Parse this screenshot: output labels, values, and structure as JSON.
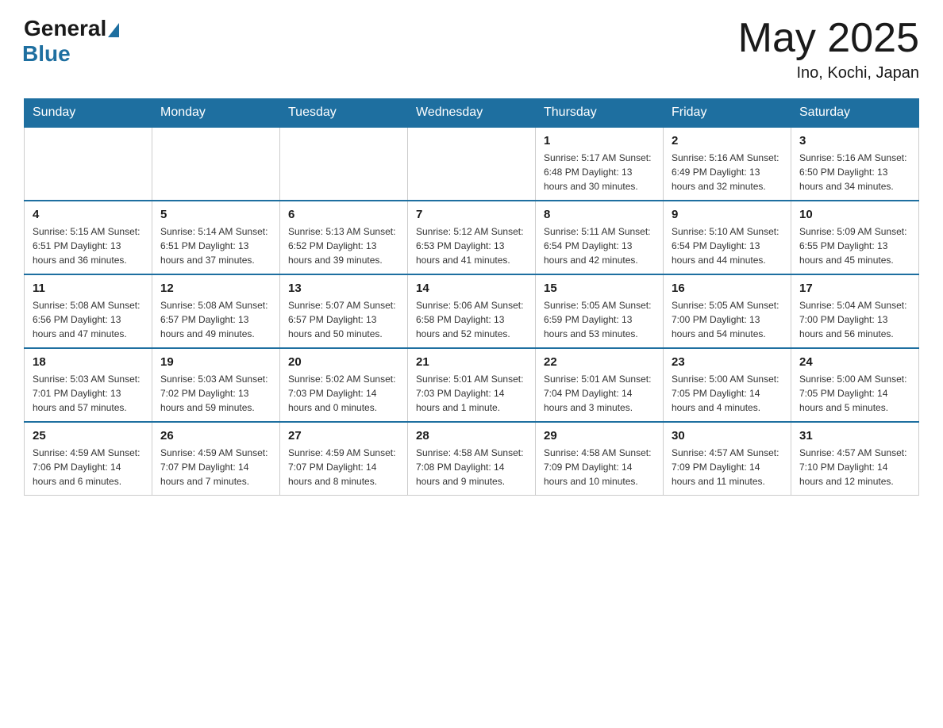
{
  "header": {
    "logo_general": "General",
    "logo_blue": "Blue",
    "month": "May 2025",
    "location": "Ino, Kochi, Japan"
  },
  "weekdays": [
    "Sunday",
    "Monday",
    "Tuesday",
    "Wednesday",
    "Thursday",
    "Friday",
    "Saturday"
  ],
  "weeks": [
    [
      {
        "day": "",
        "info": ""
      },
      {
        "day": "",
        "info": ""
      },
      {
        "day": "",
        "info": ""
      },
      {
        "day": "",
        "info": ""
      },
      {
        "day": "1",
        "info": "Sunrise: 5:17 AM\nSunset: 6:48 PM\nDaylight: 13 hours\nand 30 minutes."
      },
      {
        "day": "2",
        "info": "Sunrise: 5:16 AM\nSunset: 6:49 PM\nDaylight: 13 hours\nand 32 minutes."
      },
      {
        "day": "3",
        "info": "Sunrise: 5:16 AM\nSunset: 6:50 PM\nDaylight: 13 hours\nand 34 minutes."
      }
    ],
    [
      {
        "day": "4",
        "info": "Sunrise: 5:15 AM\nSunset: 6:51 PM\nDaylight: 13 hours\nand 36 minutes."
      },
      {
        "day": "5",
        "info": "Sunrise: 5:14 AM\nSunset: 6:51 PM\nDaylight: 13 hours\nand 37 minutes."
      },
      {
        "day": "6",
        "info": "Sunrise: 5:13 AM\nSunset: 6:52 PM\nDaylight: 13 hours\nand 39 minutes."
      },
      {
        "day": "7",
        "info": "Sunrise: 5:12 AM\nSunset: 6:53 PM\nDaylight: 13 hours\nand 41 minutes."
      },
      {
        "day": "8",
        "info": "Sunrise: 5:11 AM\nSunset: 6:54 PM\nDaylight: 13 hours\nand 42 minutes."
      },
      {
        "day": "9",
        "info": "Sunrise: 5:10 AM\nSunset: 6:54 PM\nDaylight: 13 hours\nand 44 minutes."
      },
      {
        "day": "10",
        "info": "Sunrise: 5:09 AM\nSunset: 6:55 PM\nDaylight: 13 hours\nand 45 minutes."
      }
    ],
    [
      {
        "day": "11",
        "info": "Sunrise: 5:08 AM\nSunset: 6:56 PM\nDaylight: 13 hours\nand 47 minutes."
      },
      {
        "day": "12",
        "info": "Sunrise: 5:08 AM\nSunset: 6:57 PM\nDaylight: 13 hours\nand 49 minutes."
      },
      {
        "day": "13",
        "info": "Sunrise: 5:07 AM\nSunset: 6:57 PM\nDaylight: 13 hours\nand 50 minutes."
      },
      {
        "day": "14",
        "info": "Sunrise: 5:06 AM\nSunset: 6:58 PM\nDaylight: 13 hours\nand 52 minutes."
      },
      {
        "day": "15",
        "info": "Sunrise: 5:05 AM\nSunset: 6:59 PM\nDaylight: 13 hours\nand 53 minutes."
      },
      {
        "day": "16",
        "info": "Sunrise: 5:05 AM\nSunset: 7:00 PM\nDaylight: 13 hours\nand 54 minutes."
      },
      {
        "day": "17",
        "info": "Sunrise: 5:04 AM\nSunset: 7:00 PM\nDaylight: 13 hours\nand 56 minutes."
      }
    ],
    [
      {
        "day": "18",
        "info": "Sunrise: 5:03 AM\nSunset: 7:01 PM\nDaylight: 13 hours\nand 57 minutes."
      },
      {
        "day": "19",
        "info": "Sunrise: 5:03 AM\nSunset: 7:02 PM\nDaylight: 13 hours\nand 59 minutes."
      },
      {
        "day": "20",
        "info": "Sunrise: 5:02 AM\nSunset: 7:03 PM\nDaylight: 14 hours\nand 0 minutes."
      },
      {
        "day": "21",
        "info": "Sunrise: 5:01 AM\nSunset: 7:03 PM\nDaylight: 14 hours\nand 1 minute."
      },
      {
        "day": "22",
        "info": "Sunrise: 5:01 AM\nSunset: 7:04 PM\nDaylight: 14 hours\nand 3 minutes."
      },
      {
        "day": "23",
        "info": "Sunrise: 5:00 AM\nSunset: 7:05 PM\nDaylight: 14 hours\nand 4 minutes."
      },
      {
        "day": "24",
        "info": "Sunrise: 5:00 AM\nSunset: 7:05 PM\nDaylight: 14 hours\nand 5 minutes."
      }
    ],
    [
      {
        "day": "25",
        "info": "Sunrise: 4:59 AM\nSunset: 7:06 PM\nDaylight: 14 hours\nand 6 minutes."
      },
      {
        "day": "26",
        "info": "Sunrise: 4:59 AM\nSunset: 7:07 PM\nDaylight: 14 hours\nand 7 minutes."
      },
      {
        "day": "27",
        "info": "Sunrise: 4:59 AM\nSunset: 7:07 PM\nDaylight: 14 hours\nand 8 minutes."
      },
      {
        "day": "28",
        "info": "Sunrise: 4:58 AM\nSunset: 7:08 PM\nDaylight: 14 hours\nand 9 minutes."
      },
      {
        "day": "29",
        "info": "Sunrise: 4:58 AM\nSunset: 7:09 PM\nDaylight: 14 hours\nand 10 minutes."
      },
      {
        "day": "30",
        "info": "Sunrise: 4:57 AM\nSunset: 7:09 PM\nDaylight: 14 hours\nand 11 minutes."
      },
      {
        "day": "31",
        "info": "Sunrise: 4:57 AM\nSunset: 7:10 PM\nDaylight: 14 hours\nand 12 minutes."
      }
    ]
  ]
}
